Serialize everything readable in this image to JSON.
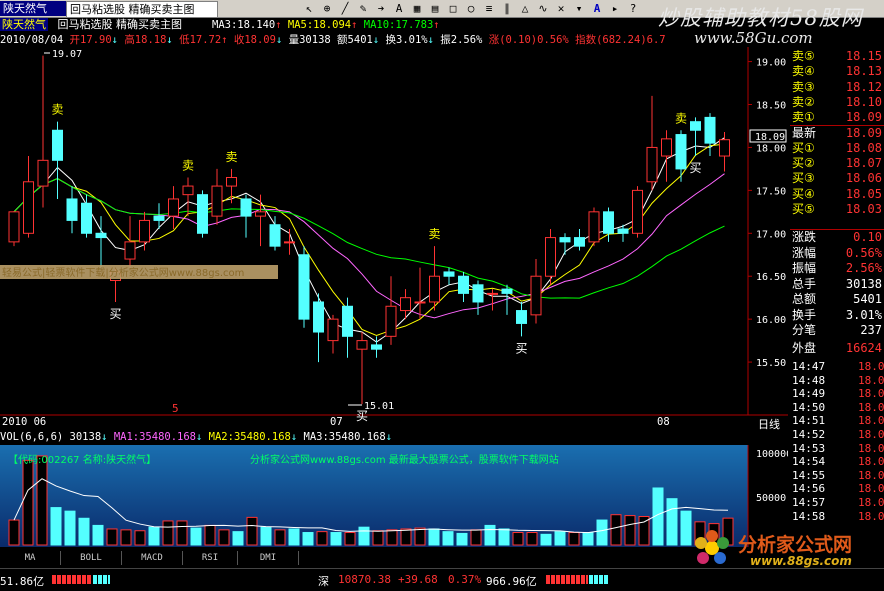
{
  "toolbar": {
    "title": "陕天然气",
    "formula_name": "回马粘选股 精确买卖主图",
    "ma3": "MA3:18.140",
    "ma5": "MA5:18.094",
    "ma10": "MA10:17.783",
    "icons": [
      "cursor-icon",
      "zoom-icon",
      "line-icon",
      "pen-icon",
      "arrow-icon",
      "text-icon",
      "grid-icon",
      "help-icon"
    ]
  },
  "watermark_top": {
    "line1": "炒股辅助教材58股网",
    "line2": "www.58Gu.com"
  },
  "quote_header": {
    "date": "2010/08/04",
    "open": "开17.90",
    "high": "高18.18",
    "low": "低17.72",
    "close": "收18.09",
    "volume": "量30138",
    "amount": "额5401",
    "turnover": "换3.01%",
    "amplitude": "振2.56%",
    "change": "涨(0.10)0.56%",
    "index": "指数(682.24)6.7"
  },
  "main_chart": {
    "y_ticks": [
      "18.50",
      "18.00",
      "17.50",
      "17.00",
      "16.50",
      "16.00",
      "15.50"
    ],
    "top_tick": "19.00",
    "current_price_tag": "18.09",
    "high_label": "19.07",
    "low_label": "15.01",
    "overlay_text": "轻易公式|轻票软件下载|分析家公式网www.88gs.com",
    "buy_label": "买",
    "sell_label": "卖",
    "marker_5": "5",
    "date_labels": [
      "2010 06",
      "07",
      "08"
    ],
    "date_right": "日线",
    "colors": {
      "up": "#ff3333",
      "down": "#54ffff",
      "ma3": "#ffffff",
      "ma5": "#ffff00",
      "ma10": "#ff66ff",
      "ma20": "#00ff00",
      "signal": "#ffff00"
    }
  },
  "chart_data": {
    "type": "candlestick",
    "ylim": [
      15.0,
      19.1
    ],
    "candles": [
      {
        "o": 16.9,
        "c": 17.25,
        "h": 17.25,
        "l": 16.85
      },
      {
        "o": 17.0,
        "c": 17.6,
        "h": 17.9,
        "l": 16.95
      },
      {
        "o": 17.55,
        "c": 17.85,
        "h": 19.07,
        "l": 17.3
      },
      {
        "o": 18.2,
        "c": 17.85,
        "h": 18.3,
        "l": 17.4
      },
      {
        "o": 17.4,
        "c": 17.15,
        "h": 17.55,
        "l": 17.0
      },
      {
        "o": 17.35,
        "c": 17.0,
        "h": 17.45,
        "l": 16.95
      },
      {
        "o": 17.0,
        "c": 16.95,
        "h": 17.2,
        "l": 16.6
      },
      {
        "o": 16.45,
        "c": 16.55,
        "h": 16.6,
        "l": 16.2
      },
      {
        "o": 16.7,
        "c": 16.9,
        "h": 17.2,
        "l": 16.6
      },
      {
        "o": 16.9,
        "c": 17.15,
        "h": 17.25,
        "l": 16.8
      },
      {
        "o": 17.2,
        "c": 17.15,
        "h": 17.35,
        "l": 17.05
      },
      {
        "o": 17.2,
        "c": 17.4,
        "h": 17.55,
        "l": 17.05
      },
      {
        "o": 17.45,
        "c": 17.55,
        "h": 17.65,
        "l": 17.2
      },
      {
        "o": 17.45,
        "c": 17.0,
        "h": 17.5,
        "l": 16.95
      },
      {
        "o": 17.2,
        "c": 17.55,
        "h": 17.75,
        "l": 17.1
      },
      {
        "o": 17.55,
        "c": 17.65,
        "h": 17.75,
        "l": 17.35
      },
      {
        "o": 17.4,
        "c": 17.2,
        "h": 17.45,
        "l": 16.95
      },
      {
        "o": 17.2,
        "c": 17.25,
        "h": 17.45,
        "l": 16.85
      },
      {
        "o": 17.1,
        "c": 16.85,
        "h": 17.2,
        "l": 16.8
      },
      {
        "o": 16.9,
        "c": 16.9,
        "h": 17.05,
        "l": 16.75
      },
      {
        "o": 16.75,
        "c": 16.0,
        "h": 16.85,
        "l": 15.9
      },
      {
        "o": 16.2,
        "c": 15.85,
        "h": 16.3,
        "l": 15.5
      },
      {
        "o": 15.75,
        "c": 16.0,
        "h": 16.05,
        "l": 15.6
      },
      {
        "o": 16.15,
        "c": 15.8,
        "h": 16.25,
        "l": 15.55
      },
      {
        "o": 15.65,
        "c": 15.75,
        "h": 15.85,
        "l": 15.01
      },
      {
        "o": 15.7,
        "c": 15.65,
        "h": 15.8,
        "l": 15.55
      },
      {
        "o": 15.8,
        "c": 16.15,
        "h": 16.5,
        "l": 15.7
      },
      {
        "o": 16.1,
        "c": 16.25,
        "h": 16.35,
        "l": 16.0
      },
      {
        "o": 16.2,
        "c": 16.2,
        "h": 16.6,
        "l": 16.0
      },
      {
        "o": 16.2,
        "c": 16.5,
        "h": 16.85,
        "l": 16.1
      },
      {
        "o": 16.55,
        "c": 16.5,
        "h": 16.6,
        "l": 16.4
      },
      {
        "o": 16.5,
        "c": 16.3,
        "h": 16.55,
        "l": 16.2
      },
      {
        "o": 16.4,
        "c": 16.2,
        "h": 16.45,
        "l": 16.05
      },
      {
        "o": 16.3,
        "c": 16.3,
        "h": 16.35,
        "l": 16.1
      },
      {
        "o": 16.35,
        "c": 16.3,
        "h": 16.4,
        "l": 16.05
      },
      {
        "o": 16.1,
        "c": 15.95,
        "h": 16.2,
        "l": 15.8
      },
      {
        "o": 16.05,
        "c": 16.5,
        "h": 16.7,
        "l": 15.95
      },
      {
        "o": 16.5,
        "c": 16.95,
        "h": 17.05,
        "l": 16.4
      },
      {
        "o": 16.95,
        "c": 16.9,
        "h": 17.0,
        "l": 16.75
      },
      {
        "o": 16.95,
        "c": 16.85,
        "h": 17.05,
        "l": 16.8
      },
      {
        "o": 16.9,
        "c": 17.25,
        "h": 17.3,
        "l": 16.85
      },
      {
        "o": 17.25,
        "c": 17.0,
        "h": 17.3,
        "l": 16.9
      },
      {
        "o": 17.05,
        "c": 17.0,
        "h": 17.1,
        "l": 16.9
      },
      {
        "o": 17.0,
        "c": 17.5,
        "h": 17.55,
        "l": 16.95
      },
      {
        "o": 17.6,
        "c": 18.0,
        "h": 18.6,
        "l": 17.5
      },
      {
        "o": 17.9,
        "c": 18.1,
        "h": 18.2,
        "l": 17.6
      },
      {
        "o": 18.15,
        "c": 17.75,
        "h": 18.2,
        "l": 17.6
      },
      {
        "o": 18.3,
        "c": 18.2,
        "h": 18.35,
        "l": 17.9
      },
      {
        "o": 18.35,
        "c": 18.05,
        "h": 18.4,
        "l": 17.9
      },
      {
        "o": 17.9,
        "c": 18.09,
        "h": 18.18,
        "l": 17.72
      }
    ],
    "buy_signals": [
      7,
      24,
      35,
      47
    ],
    "sell_signals": [
      3,
      12,
      15,
      29,
      46
    ]
  },
  "volume_header": {
    "vol": "VOL(6,6,6) 30138",
    "ma1": "MA1:35480.168",
    "ma2": "MA2:35480.168",
    "ma3": "MA3:35480.168"
  },
  "volume_panel": {
    "info_left": "【代码:002267 名称:陕天然气】",
    "info_center": "分析家公式网www.88gs.com 最新最大股票公式，股票软件下载网站",
    "y_ticks": [
      "100000",
      "50000"
    ],
    "volumes": [
      28000,
      95000,
      100000,
      42000,
      38000,
      30000,
      22000,
      18000,
      17000,
      16000,
      20000,
      27000,
      27000,
      19000,
      22000,
      17000,
      15000,
      31000,
      20000,
      17000,
      18000,
      14000,
      15000,
      14000,
      14000,
      20000,
      16000,
      17000,
      18000,
      19000,
      18000,
      15000,
      13000,
      17000,
      22000,
      18000,
      14000,
      14000,
      12000,
      15000,
      14000,
      14000,
      28000,
      34000,
      33000,
      32000,
      64000,
      52000,
      38000,
      26000,
      24000,
      30138
    ]
  },
  "indicator_tabs": [
    "MA",
    "BOLL",
    "MACD",
    "RSI",
    "DMI"
  ],
  "right_panel": {
    "order_book": [
      {
        "label": "卖⑤",
        "value": "18.15"
      },
      {
        "label": "卖④",
        "value": "18.13"
      },
      {
        "label": "卖③",
        "value": "18.12"
      },
      {
        "label": "卖②",
        "value": "18.10"
      },
      {
        "label": "卖①",
        "value": "18.09"
      },
      {
        "label": "最新",
        "value": "18.09"
      },
      {
        "label": "买①",
        "value": "18.08"
      },
      {
        "label": "买②",
        "value": "18.07"
      },
      {
        "label": "买③",
        "value": "18.06"
      },
      {
        "label": "买④",
        "value": "18.05"
      },
      {
        "label": "买⑤",
        "value": "18.03"
      }
    ],
    "stats": [
      {
        "label": "涨跌",
        "value": "0.10"
      },
      {
        "label": "涨幅",
        "value": "0.56%"
      },
      {
        "label": "振幅",
        "value": "2.56%"
      },
      {
        "label": "总手",
        "value": "30138"
      },
      {
        "label": "总额",
        "value": "5401"
      },
      {
        "label": "换手",
        "value": "3.01%"
      },
      {
        "label": "分笔",
        "value": "237"
      }
    ],
    "outer_label": "外盘",
    "outer_value": "16624",
    "trades": [
      {
        "time": "14:47",
        "price": "18.0"
      },
      {
        "time": "14:48",
        "price": "18.0"
      },
      {
        "time": "14:49",
        "price": "18.0"
      },
      {
        "time": "14:50",
        "price": "18.0"
      },
      {
        "time": "14:51",
        "price": "18.0"
      },
      {
        "time": "14:52",
        "price": "18.0"
      },
      {
        "time": "14:53",
        "price": "18.0"
      },
      {
        "time": "14:54",
        "price": "18.0"
      },
      {
        "time": "14:55",
        "price": "18.0"
      },
      {
        "time": "14:56",
        "price": "18.0"
      },
      {
        "time": "14:57",
        "price": "18.0"
      },
      {
        "time": "14:58",
        "price": "18.0"
      }
    ]
  },
  "status_bar": {
    "left_value": "51.86亿",
    "market": "深",
    "index_value": "10870.38",
    "index_change": "+39.68",
    "index_pct": "0.37%",
    "amount": "966.96亿"
  },
  "watermark_bottom": {
    "line1": "分析家公式网",
    "line2": "www.88gs.com"
  }
}
